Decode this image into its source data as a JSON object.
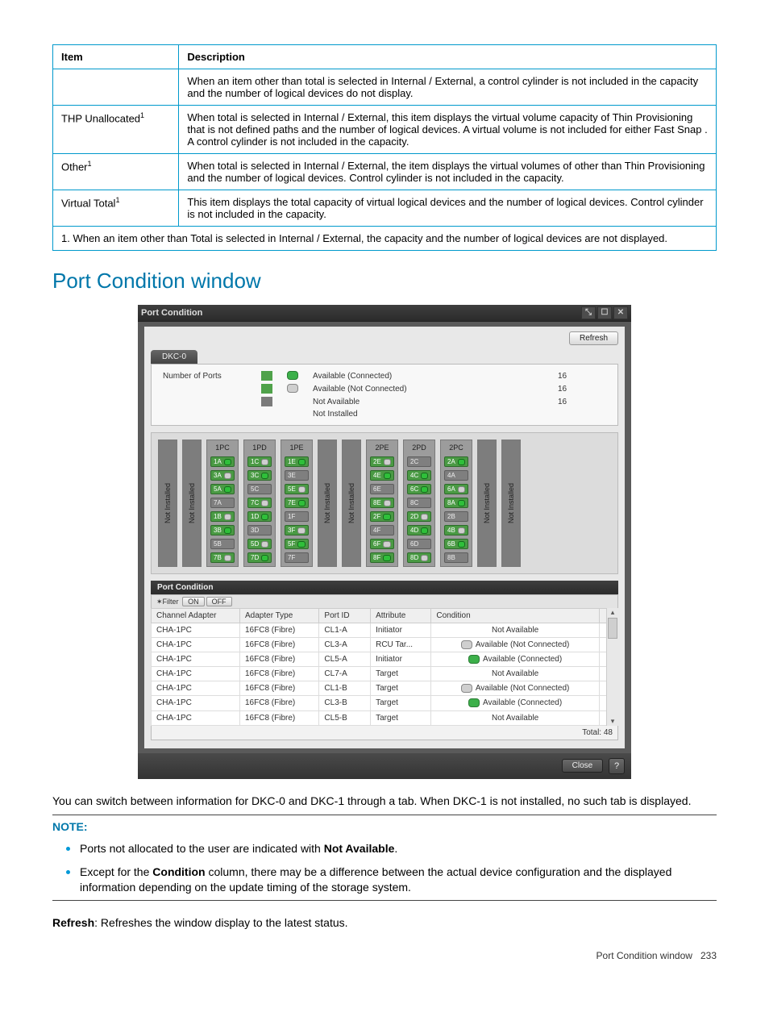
{
  "defTable": {
    "headers": [
      "Item",
      "Description"
    ],
    "rows": [
      {
        "item": "",
        "desc": "When an item other than total is selected in Internal / External, a control cylinder is not included in the capacity and the number of logical devices do not display."
      },
      {
        "item": "THP Unallocated",
        "sup": "1",
        "desc": "When total is selected in Internal / External, this item displays the virtual volume capacity of Thin Provisioning that is not defined paths and the number of logical devices. A virtual volume is not included for either Fast Snap . A control cylinder is not included in the capacity."
      },
      {
        "item": "Other",
        "sup": "1",
        "desc": "When total is selected in Internal / External, the item displays the virtual volumes of other than Thin Provisioning and the number of logical devices. Control cylinder is not included in the capacity."
      },
      {
        "item": "Virtual Total",
        "sup": "1",
        "desc": "This item displays the total capacity of virtual logical devices and the number of logical devices. Control cylinder is not included in the capacity."
      }
    ],
    "footnote": "1. When an item other than Total is selected in Internal / External, the capacity and the number of logical devices are not displayed."
  },
  "sectionTitle": "Port Condition window",
  "shot": {
    "title": "Port Condition",
    "refresh": "Refresh",
    "tab": "DKC-0",
    "summary": {
      "label": "Number of Ports",
      "rows": [
        {
          "swatch": "g1",
          "led": "green",
          "text": "Available (Connected)",
          "count": "16"
        },
        {
          "swatch": "g2",
          "led": "grey",
          "text": "Available (Not Connected)",
          "count": "16"
        },
        {
          "swatch": "na",
          "led": "",
          "text": "Not Available",
          "count": "16"
        },
        {
          "swatch": "",
          "led": "",
          "text": "Not Installed",
          "count": ""
        }
      ]
    },
    "board": {
      "naLabel": "Not Installed",
      "groups": [
        {
          "headers": [
            "1PC",
            "1PD",
            "1PE"
          ],
          "cols": [
            [
              {
                "t": "1A",
                "s": "a",
                "l": ""
              },
              {
                "t": "3A",
                "s": "a",
                "l": "off"
              },
              {
                "t": "5A",
                "s": "a",
                "l": "on"
              },
              {
                "t": "7A",
                "s": "n",
                "l": ""
              },
              {
                "t": "1B",
                "s": "a",
                "l": "off"
              },
              {
                "t": "3B",
                "s": "a",
                "l": "on"
              },
              {
                "t": "5B",
                "s": "n",
                "l": ""
              },
              {
                "t": "7B",
                "s": "a",
                "l": "off"
              }
            ],
            [
              {
                "t": "1C",
                "s": "a",
                "l": "off"
              },
              {
                "t": "3C",
                "s": "a",
                "l": "on"
              },
              {
                "t": "5C",
                "s": "n",
                "l": ""
              },
              {
                "t": "7C",
                "s": "a",
                "l": "off"
              },
              {
                "t": "1D",
                "s": "a",
                "l": "on"
              },
              {
                "t": "3D",
                "s": "n",
                "l": ""
              },
              {
                "t": "5D",
                "s": "a",
                "l": "off"
              },
              {
                "t": "7D",
                "s": "a",
                "l": "on"
              }
            ],
            [
              {
                "t": "1E",
                "s": "a",
                "l": "on"
              },
              {
                "t": "3E",
                "s": "n",
                "l": ""
              },
              {
                "t": "5E",
                "s": "a",
                "l": "off"
              },
              {
                "t": "7E",
                "s": "a",
                "l": "on"
              },
              {
                "t": "1F",
                "s": "n",
                "l": ""
              },
              {
                "t": "3F",
                "s": "a",
                "l": "off"
              },
              {
                "t": "5F",
                "s": "a",
                "l": "on"
              },
              {
                "t": "7F",
                "s": "n",
                "l": ""
              }
            ]
          ]
        },
        {
          "headers": [
            "2PE",
            "2PD",
            "2PC"
          ],
          "cols": [
            [
              {
                "t": "2E",
                "s": "a",
                "l": "off"
              },
              {
                "t": "4E",
                "s": "a",
                "l": "on"
              },
              {
                "t": "6E",
                "s": "n",
                "l": ""
              },
              {
                "t": "8E",
                "s": "a",
                "l": "off"
              },
              {
                "t": "2F",
                "s": "a",
                "l": "on"
              },
              {
                "t": "4F",
                "s": "n",
                "l": ""
              },
              {
                "t": "6F",
                "s": "a",
                "l": "off"
              },
              {
                "t": "8F",
                "s": "a",
                "l": "on"
              }
            ],
            [
              {
                "t": "2C",
                "s": "n",
                "l": ""
              },
              {
                "t": "4C",
                "s": "a",
                "l": "on"
              },
              {
                "t": "6C",
                "s": "a",
                "l": "on"
              },
              {
                "t": "8C",
                "s": "n",
                "l": ""
              },
              {
                "t": "2D",
                "s": "a",
                "l": "off"
              },
              {
                "t": "4D",
                "s": "a",
                "l": "on"
              },
              {
                "t": "6D",
                "s": "n",
                "l": ""
              },
              {
                "t": "8D",
                "s": "a",
                "l": "off"
              }
            ],
            [
              {
                "t": "2A",
                "s": "a",
                "l": "on"
              },
              {
                "t": "4A",
                "s": "n",
                "l": ""
              },
              {
                "t": "6A",
                "s": "a",
                "l": "off"
              },
              {
                "t": "8A",
                "s": "a",
                "l": "on"
              },
              {
                "t": "2B",
                "s": "n",
                "l": ""
              },
              {
                "t": "4B",
                "s": "a",
                "l": "off"
              },
              {
                "t": "6B",
                "s": "a",
                "l": "on"
              },
              {
                "t": "8B",
                "s": "n",
                "l": ""
              }
            ]
          ]
        }
      ]
    },
    "gridHeader": "Port Condition",
    "filter": {
      "label": "Filter",
      "on": "ON",
      "off": "OFF"
    },
    "cols": [
      "Channel Adapter",
      "Adapter Type",
      "Port ID",
      "Attribute",
      "Condition"
    ],
    "rows": [
      {
        "ca": "CHA-1PC",
        "at": "16FC8 (Fibre)",
        "pid": "CL1-A",
        "attr": "Initiator",
        "led": "",
        "cond": "Not Available"
      },
      {
        "ca": "CHA-1PC",
        "at": "16FC8 (Fibre)",
        "pid": "CL3-A",
        "attr": "RCU Tar...",
        "led": "grey",
        "cond": "Available (Not Connected)"
      },
      {
        "ca": "CHA-1PC",
        "at": "16FC8 (Fibre)",
        "pid": "CL5-A",
        "attr": "Initiator",
        "led": "green",
        "cond": "Available (Connected)"
      },
      {
        "ca": "CHA-1PC",
        "at": "16FC8 (Fibre)",
        "pid": "CL7-A",
        "attr": "Target",
        "led": "",
        "cond": "Not Available"
      },
      {
        "ca": "CHA-1PC",
        "at": "16FC8 (Fibre)",
        "pid": "CL1-B",
        "attr": "Target",
        "led": "grey",
        "cond": "Available (Not Connected)"
      },
      {
        "ca": "CHA-1PC",
        "at": "16FC8 (Fibre)",
        "pid": "CL3-B",
        "attr": "Target",
        "led": "green",
        "cond": "Available (Connected)"
      },
      {
        "ca": "CHA-1PC",
        "at": "16FC8 (Fibre)",
        "pid": "CL5-B",
        "attr": "Target",
        "led": "",
        "cond": "Not Available"
      }
    ],
    "total": "Total:  48",
    "close": "Close"
  },
  "narr": {
    "p1": "You can switch between information for DKC-0 and DKC-1 through a tab. When DKC-1 is not installed, no such tab is displayed.",
    "noteLabel": "NOTE:",
    "n1a": "Ports not allocated to the user are indicated with ",
    "n1b": "Not Available",
    "n1c": ".",
    "n2a": "Except for the ",
    "n2b": "Condition",
    "n2c": " column, there may be a difference between the actual device configuration and the displayed information depending on the update timing of the storage system.",
    "refreshLabel": "Refresh",
    "refreshText": ": Refreshes the window display to the latest status."
  },
  "pageFoot": {
    "label": "Port Condition window",
    "num": "233"
  }
}
